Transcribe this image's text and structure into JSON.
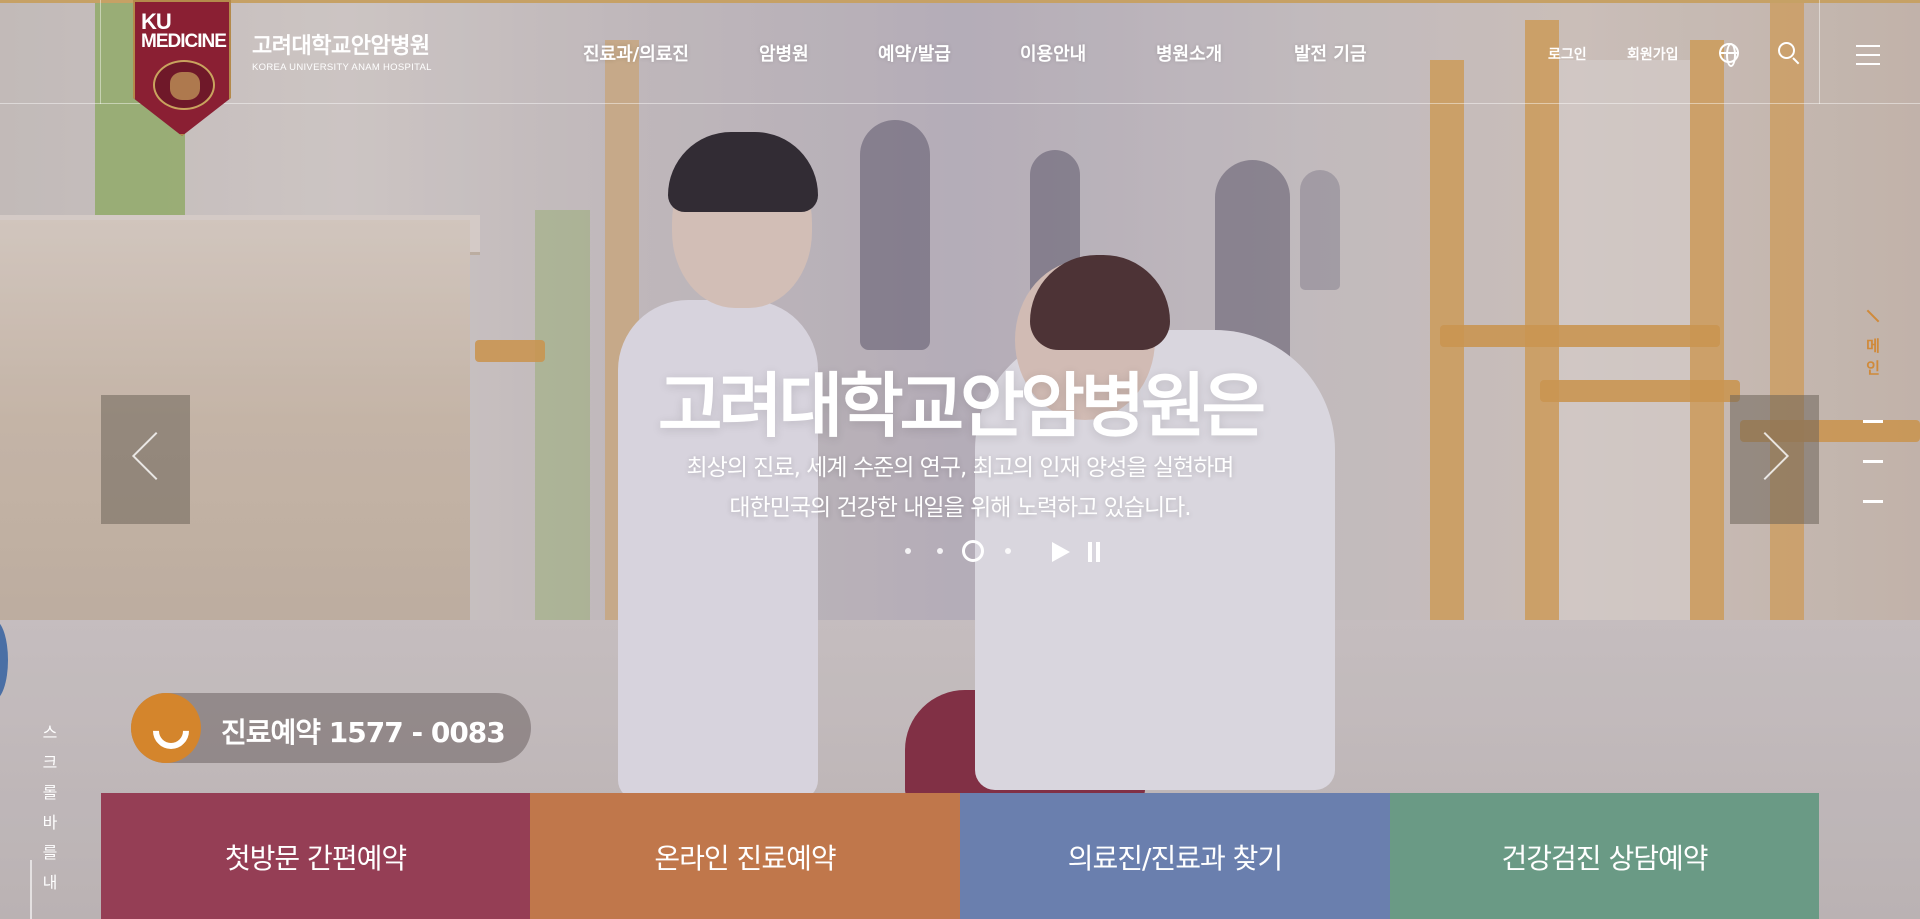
{
  "header": {
    "logo": {
      "ku": "KU",
      "medicine": "MEDICINE",
      "name_ko": "고려대학교안암병원",
      "name_en": "KOREA UNIVERSITY ANAM HOSPITAL"
    },
    "nav": [
      "진료과/의료진",
      "암병원",
      "예약/발급",
      "이용안내",
      "병원소개",
      "발전 기금"
    ],
    "util": {
      "login": "로그인",
      "signup": "회원가입"
    },
    "icons": [
      "globe-icon",
      "search-icon",
      "menu-icon"
    ]
  },
  "hero": {
    "title": "고려대학교안암병원은",
    "subtitle_line1": "최상의 진료, 세계 수준의 연구, 최고의 인재 양성을 실현하며",
    "subtitle_line2": "대한민국의 건강한 내일을 위해 노력하고 있습니다.",
    "slide_count": 4,
    "active_slide": 3
  },
  "side_nav": {
    "label": "메인",
    "items_count": 3
  },
  "scroll_hint": "스크롤바를 내",
  "reservation": {
    "label": "진료예약 1577 - 0083"
  },
  "quick_menu": [
    {
      "label": "첫방문 간편예약",
      "color": "#953e55"
    },
    {
      "label": "온라인 진료예약",
      "color": "#c0774b"
    },
    {
      "label": "의료진/진료과 찾기",
      "color": "#6a7fae"
    },
    {
      "label": "건강검진 상담예약",
      "color": "#6a9a85"
    }
  ],
  "colors": {
    "accent": "#d4852c",
    "brand": "#8a1f33"
  }
}
